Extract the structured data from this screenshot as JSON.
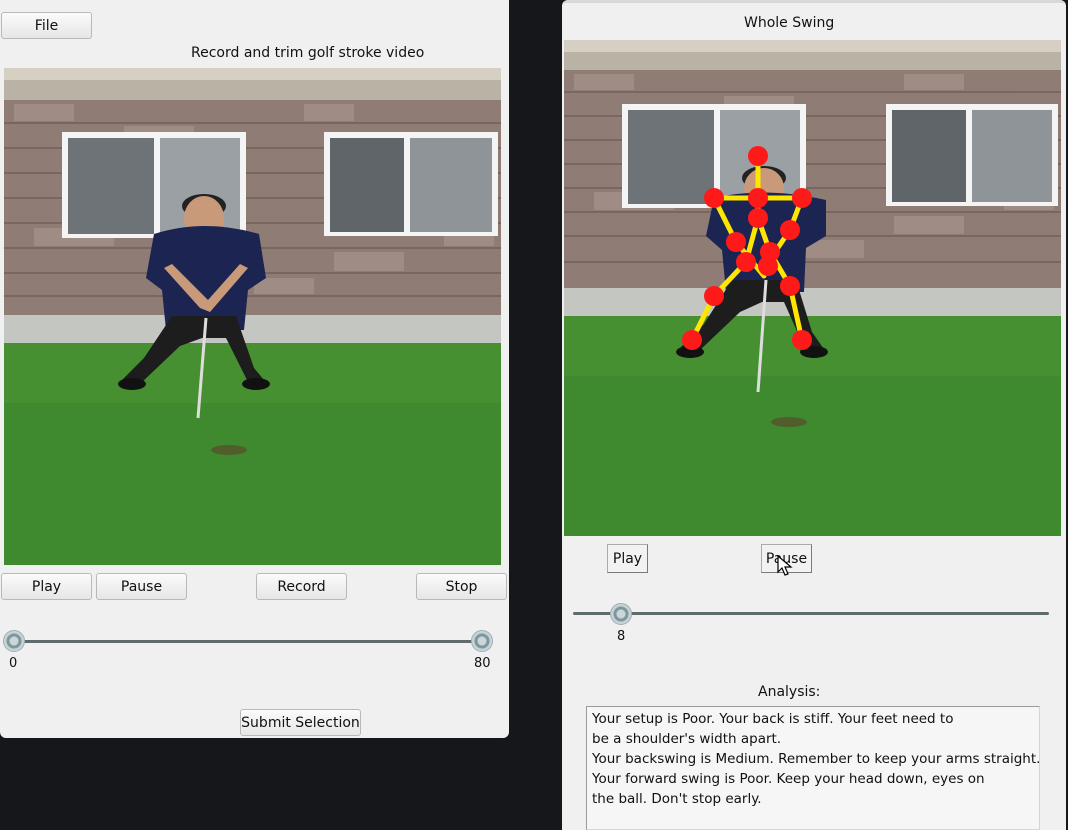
{
  "left_window": {
    "menu": {
      "file_label": "File"
    },
    "title": "Record and trim golf stroke video",
    "buttons": {
      "play": "Play",
      "pause": "Pause",
      "record": "Record",
      "stop": "Stop",
      "submit": "Submit Selection"
    },
    "trim_slider": {
      "min_label": "0",
      "max_label": "80",
      "start_value": 0,
      "end_value": 80
    }
  },
  "right_window": {
    "title": "Whole Swing",
    "buttons": {
      "play": "Play",
      "pause": "Pause"
    },
    "frame_slider": {
      "value_label": "8",
      "value": 8
    },
    "analysis_label": "Analysis:",
    "analysis_lines": [
      "Your setup is Poor. Your back is stiff. Your feet need to",
      "be a shoulder's width apart.",
      "Your backswing is Medium. Remember to keep your arms straight.",
      "Your forward swing is Poor. Keep your head down, eyes on",
      "the ball. Don't stop early."
    ]
  },
  "colors": {
    "skeleton_joint": "#ff1a1a",
    "skeleton_bone": "#ffe600",
    "grass": "#3f8a2e",
    "wall_stone": "#8c7a73"
  }
}
